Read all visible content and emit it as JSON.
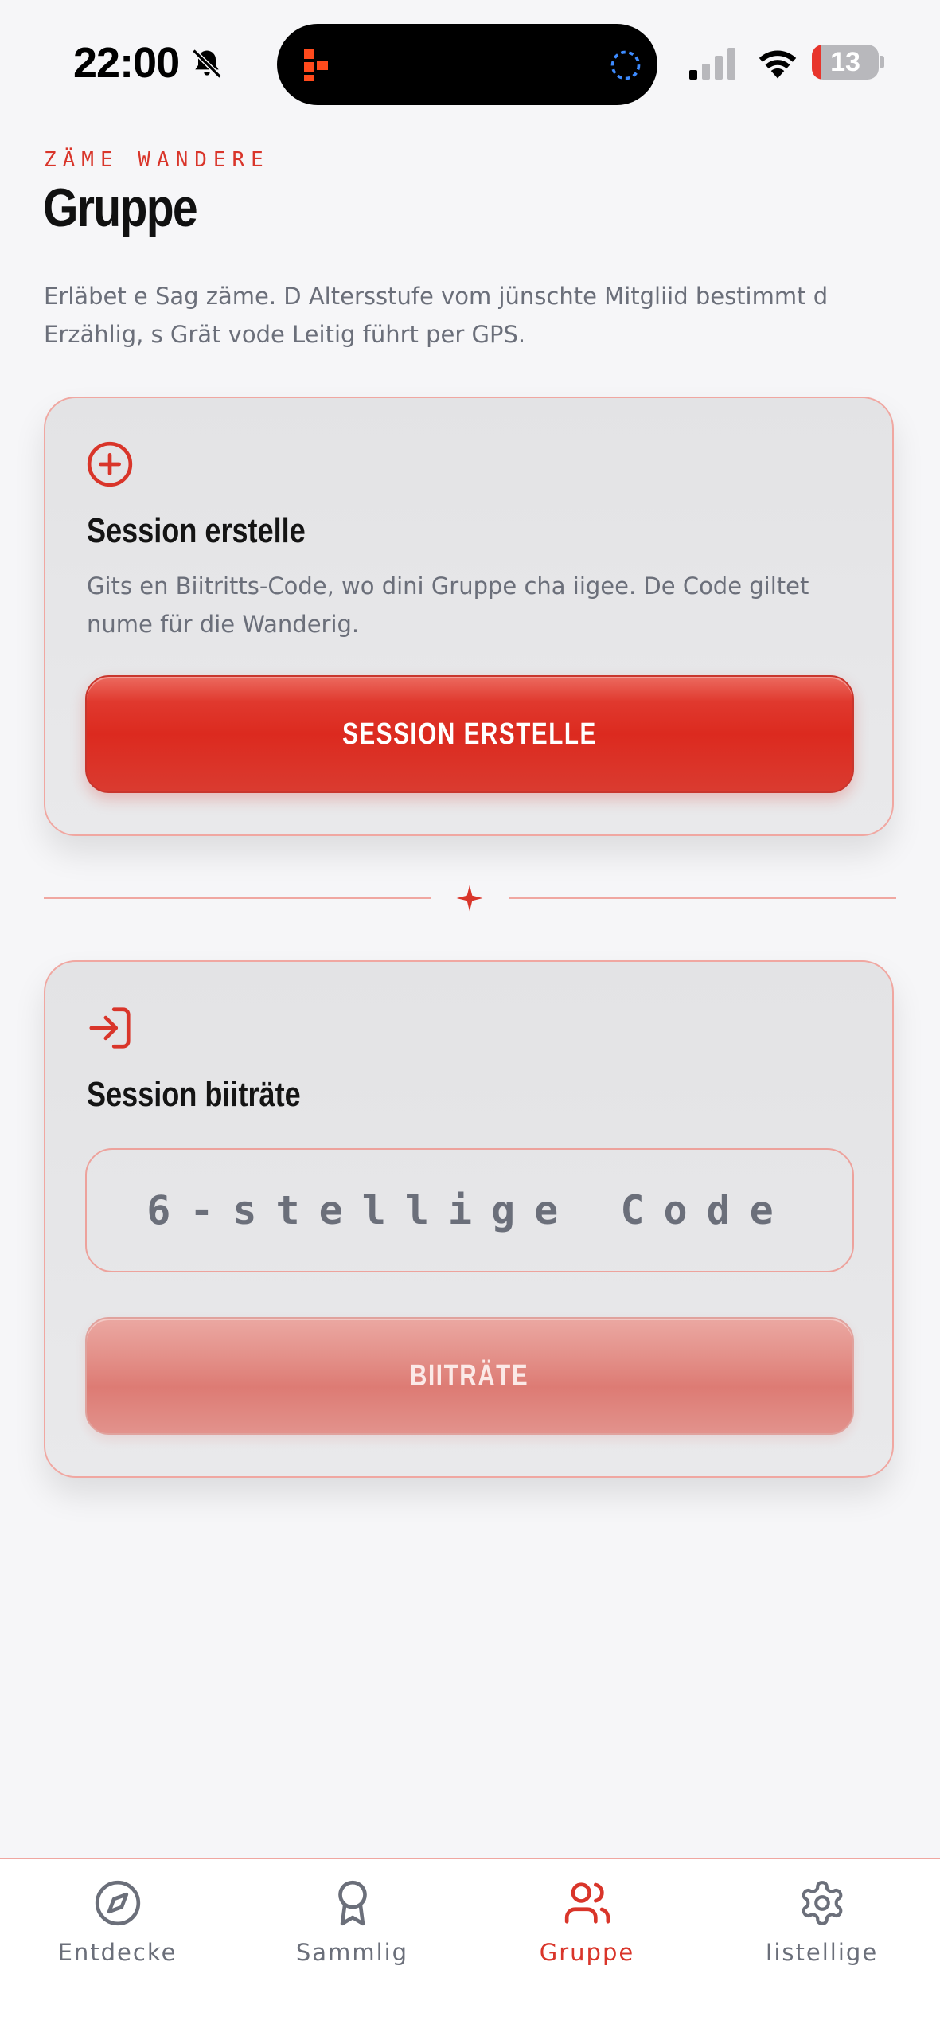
{
  "status_bar": {
    "time": "22:00",
    "battery_level": "13",
    "battery_fraction": 0.13
  },
  "header": {
    "eyebrow": "ZÄME WANDERE",
    "title": "Gruppe",
    "intro": "Erläbet e Sag zäme. D Altersstufe vom jünschte Mitgliid bestimmt d Erzählig, s Grät vode Leitig führt per GPS."
  },
  "create_card": {
    "icon": "plus-circle-icon",
    "title": "Session erstelle",
    "description": "Gits en Biitritts-Code, wo dini Gruppe cha iigee. De Code giltet nume für die Wanderig.",
    "button_label": "SESSION ERSTELLE"
  },
  "join_card": {
    "icon": "login-arrow-icon",
    "title": "Session biiträte",
    "code_placeholder": "6-stellige Code",
    "code_value": "",
    "button_label": "BIITRÄTE",
    "button_enabled": false
  },
  "tab_bar": {
    "active": "Gruppe",
    "tabs": [
      {
        "label": "Entdecke",
        "icon": "compass-icon"
      },
      {
        "label": "Sammlig",
        "icon": "award-ribbon-icon"
      },
      {
        "label": "Gruppe",
        "icon": "users-icon"
      },
      {
        "label": "Iistellige",
        "icon": "gear-icon"
      }
    ]
  },
  "colors": {
    "accent": "#d9352a",
    "accent_border": "#f0a7a1",
    "muted_text": "#6b6f7a",
    "background": "#f6f6f8"
  }
}
